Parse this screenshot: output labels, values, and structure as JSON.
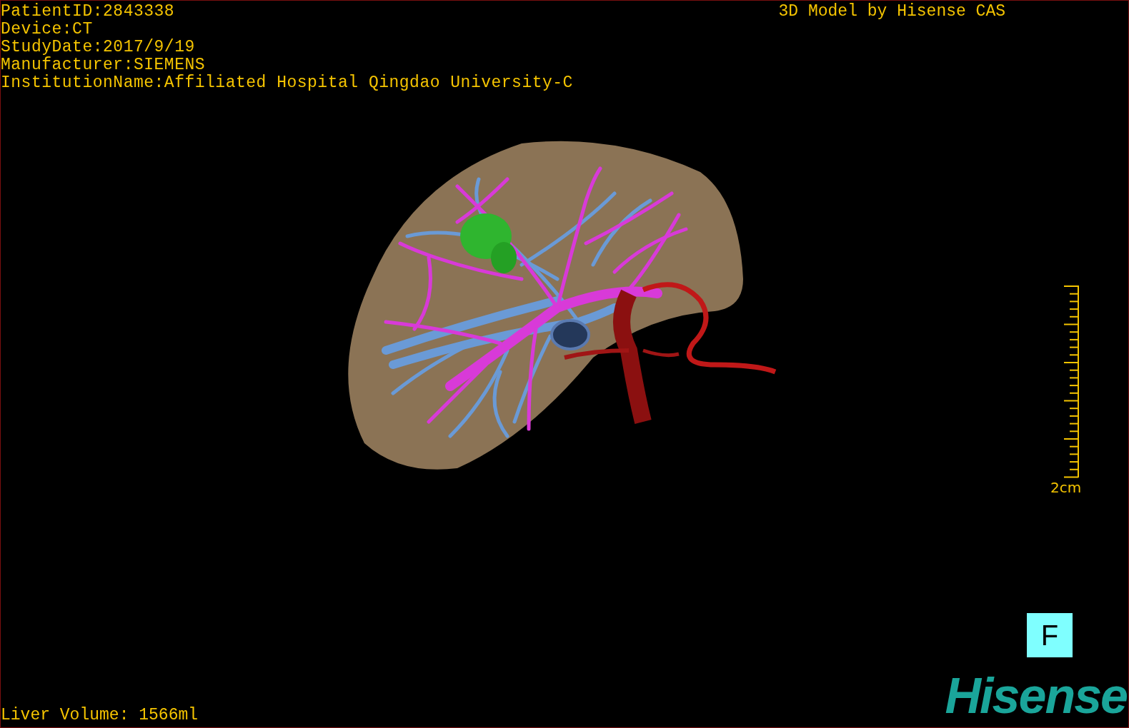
{
  "info_lines": [
    "PatientID:2843338",
    "Device:CT",
    "StudyDate:2017/9/19",
    "Manufacturer:SIEMENS",
    "InstitutionName:Affiliated Hospital Qingdao University-C"
  ],
  "title": "3D Model by Hisense CAS",
  "scale": {
    "label": "2cm"
  },
  "orientation_button": "F",
  "volume": "Liver Volume: 1566ml",
  "logo": "Hisense"
}
